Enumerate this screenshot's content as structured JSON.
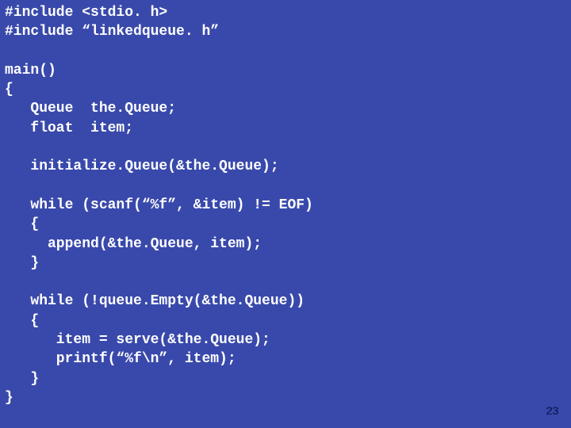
{
  "slide": {
    "code": "#include <stdio. h>\n#include “linkedqueue. h”\n\nmain()\n{\n   Queue  the.Queue;\n   float  item;\n\n   initialize.Queue(&the.Queue);\n\n   while (scanf(“%f”, &item) != EOF)\n   {\n     append(&the.Queue, item);\n   }\n\n   while (!queue.Empty(&the.Queue))\n   {\n      item = serve(&the.Queue);\n      printf(“%f\\n”, item);\n   }\n}",
    "page_number": "23"
  }
}
